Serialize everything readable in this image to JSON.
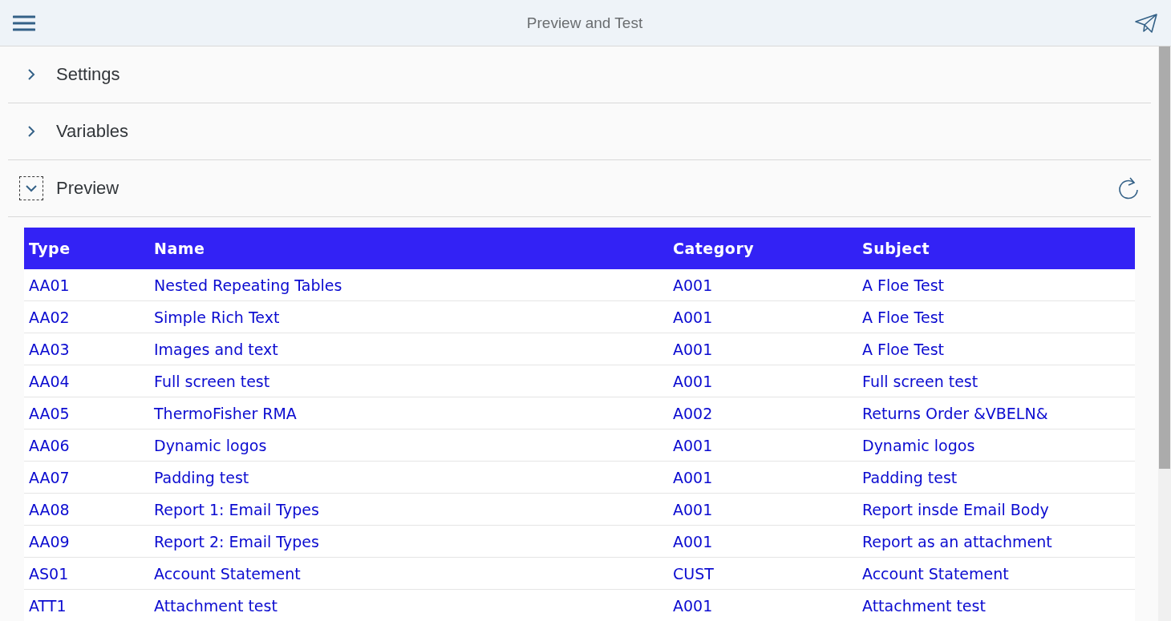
{
  "header": {
    "title": "Preview and Test"
  },
  "sections": [
    {
      "label": "Settings",
      "expanded": false,
      "focused": false
    },
    {
      "label": "Variables",
      "expanded": false,
      "focused": false
    },
    {
      "label": "Preview",
      "expanded": true,
      "focused": true,
      "table": {
        "columns": [
          "Type",
          "Name",
          "Category",
          "Subject"
        ],
        "rows": [
          [
            "AA01",
            "Nested Repeating Tables",
            "A001",
            "A Floe Test"
          ],
          [
            "AA02",
            "Simple Rich Text",
            "A001",
            "A Floe Test"
          ],
          [
            "AA03",
            "Images and text",
            "A001",
            "A Floe Test"
          ],
          [
            "AA04",
            "Full screen test",
            "A001",
            "Full screen test"
          ],
          [
            "AA05",
            "ThermoFisher RMA",
            "A002",
            "Returns Order &VBELN&"
          ],
          [
            "AA06",
            "Dynamic logos",
            "A001",
            "Dynamic logos"
          ],
          [
            "AA07",
            "Padding test",
            "A001",
            "Padding test"
          ],
          [
            "AA08",
            "Report 1: Email Types",
            "A001",
            "Report insde Email Body"
          ],
          [
            "AA09",
            "Report 2: Email Types",
            "A001",
            "Report as an attachment"
          ],
          [
            "AS01",
            "Account Statement",
            "CUST",
            "Account Statement"
          ],
          [
            "ATT1",
            "Attachment test",
            "A001",
            "Attachment test"
          ]
        ]
      }
    }
  ]
}
